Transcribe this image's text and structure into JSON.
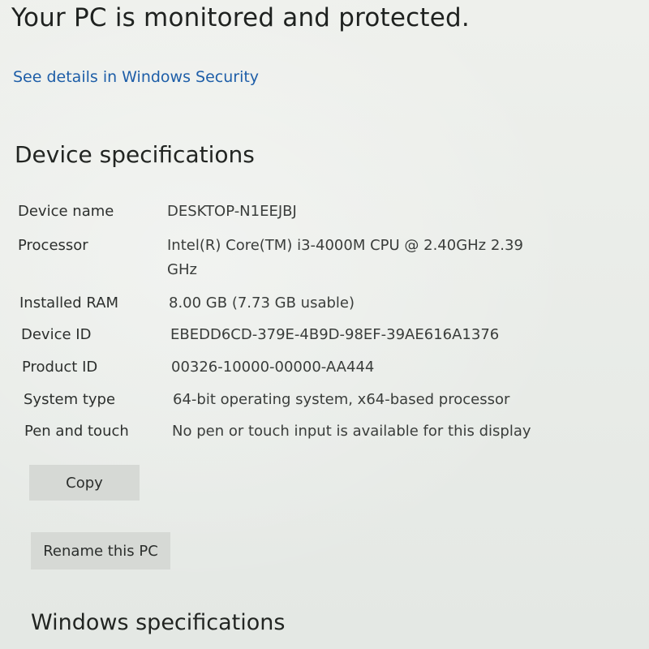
{
  "status": {
    "headline": "Your PC is monitored and protected.",
    "link": "See details in Windows Security"
  },
  "device_specs": {
    "heading": "Device specifications",
    "rows": [
      {
        "label": "Device name",
        "value": "DESKTOP-N1EEJBJ"
      },
      {
        "label": "Processor",
        "value": "Intel(R) Core(TM) i3-4000M CPU @ 2.40GHz   2.39",
        "value_cont": "GHz"
      },
      {
        "label": "Installed RAM",
        "value": "8.00 GB (7.73 GB usable)"
      },
      {
        "label": "Device ID",
        "value": "EBEDD6CD-379E-4B9D-98EF-39AE616A1376"
      },
      {
        "label": "Product ID",
        "value": "00326-10000-00000-AA444"
      },
      {
        "label": "System type",
        "value": "64-bit operating system, x64-based processor"
      },
      {
        "label": "Pen and touch",
        "value": "No pen or touch input is available for this display"
      }
    ],
    "copy_button": "Copy",
    "rename_button": "Rename this PC"
  },
  "windows_specs": {
    "heading": "Windows specifications"
  }
}
